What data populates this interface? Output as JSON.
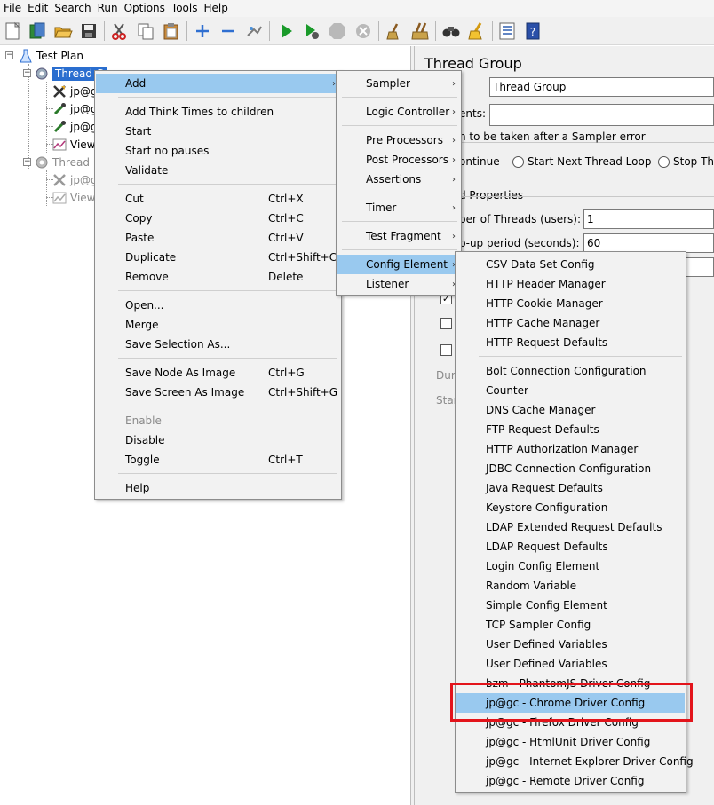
{
  "menubar": [
    "File",
    "Edit",
    "Search",
    "Run",
    "Options",
    "Tools",
    "Help"
  ],
  "toolbar": [
    "new-icon",
    "templates-icon",
    "open-icon",
    "save-icon",
    "cut-icon",
    "copy-icon",
    "paste-icon",
    "expand-icon",
    "collapse-icon",
    "toggle-icon",
    "start-icon",
    "start-no-pauses-icon",
    "stop-icon",
    "shutdown-icon",
    "clear-icon",
    "clear-all-icon",
    "search-icon",
    "reset-search-icon",
    "function-helper-icon",
    "help-icon"
  ],
  "tree": {
    "test_plan": "Test Plan",
    "thread_group_1": "Thread G",
    "child_1": "jp@g",
    "child_2": "jp@g",
    "child_3": "jp@g",
    "child_4": "View",
    "thread_group_2": "Thread",
    "child_5": "jp@g",
    "child_6": "View"
  },
  "panel": {
    "title": "Thread Group",
    "name_value": "Thread Group",
    "comments_label": "ents:",
    "error_action_label": "n to be taken after a Sampler error",
    "radio_continue": "ontinue",
    "radio_next_loop": "Start Next Thread Loop",
    "radio_stop": "Stop Thr",
    "properties_label": "d Properties",
    "threads_label": "ber of Threads (users):",
    "threads_value": "1",
    "rampup_label": "p-up period (seconds):",
    "rampup_value": "60",
    "duration_label": "Dura",
    "startup_label": "Star"
  },
  "context_menu": [
    {
      "label": "Add",
      "submenu": true,
      "highlight": true
    },
    {
      "sep": true
    },
    {
      "label": "Add Think Times to children"
    },
    {
      "label": "Start"
    },
    {
      "label": "Start no pauses"
    },
    {
      "label": "Validate"
    },
    {
      "sep": true
    },
    {
      "label": "Cut",
      "shortcut": "Ctrl+X"
    },
    {
      "label": "Copy",
      "shortcut": "Ctrl+C"
    },
    {
      "label": "Paste",
      "shortcut": "Ctrl+V"
    },
    {
      "label": "Duplicate",
      "shortcut": "Ctrl+Shift+C"
    },
    {
      "label": "Remove",
      "shortcut": "Delete"
    },
    {
      "sep": true
    },
    {
      "label": "Open..."
    },
    {
      "label": "Merge"
    },
    {
      "label": "Save Selection As..."
    },
    {
      "sep": true
    },
    {
      "label": "Save Node As Image",
      "shortcut": "Ctrl+G"
    },
    {
      "label": "Save Screen As Image",
      "shortcut": "Ctrl+Shift+G"
    },
    {
      "sep": true
    },
    {
      "label": "Enable",
      "disabled": true
    },
    {
      "label": "Disable"
    },
    {
      "label": "Toggle",
      "shortcut": "Ctrl+T"
    },
    {
      "sep": true
    },
    {
      "label": "Help"
    }
  ],
  "add_menu": [
    {
      "label": "Sampler",
      "submenu": true
    },
    {
      "sep": true
    },
    {
      "label": "Logic Controller",
      "submenu": true
    },
    {
      "sep": true
    },
    {
      "label": "Pre Processors",
      "submenu": true
    },
    {
      "label": "Post Processors",
      "submenu": true
    },
    {
      "label": "Assertions",
      "submenu": true
    },
    {
      "sep": true
    },
    {
      "label": "Timer",
      "submenu": true
    },
    {
      "sep": true
    },
    {
      "label": "Test Fragment",
      "submenu": true
    },
    {
      "sep": true
    },
    {
      "label": "Config Element",
      "submenu": true,
      "highlight": true
    },
    {
      "label": "Listener",
      "submenu": true
    }
  ],
  "config_menu": [
    {
      "label": "CSV Data Set Config"
    },
    {
      "label": "HTTP Header Manager"
    },
    {
      "label": "HTTP Cookie Manager"
    },
    {
      "label": "HTTP Cache Manager"
    },
    {
      "label": "HTTP Request Defaults"
    },
    {
      "sep": true
    },
    {
      "label": "Bolt Connection Configuration"
    },
    {
      "label": "Counter"
    },
    {
      "label": "DNS Cache Manager"
    },
    {
      "label": "FTP Request Defaults"
    },
    {
      "label": "HTTP Authorization Manager"
    },
    {
      "label": "JDBC Connection Configuration"
    },
    {
      "label": "Java Request Defaults"
    },
    {
      "label": "Keystore Configuration"
    },
    {
      "label": "LDAP Extended Request Defaults"
    },
    {
      "label": "LDAP Request Defaults"
    },
    {
      "label": "Login Config Element"
    },
    {
      "label": "Random Variable"
    },
    {
      "label": "Simple Config Element"
    },
    {
      "label": "TCP Sampler Config"
    },
    {
      "label": "User Defined Variables"
    },
    {
      "label": "User Defined Variables"
    },
    {
      "label": "bzm - PhantomJS Driver Config"
    },
    {
      "label": "jp@gc - Chrome Driver Config",
      "highlight": true
    },
    {
      "label": "jp@gc - Firefox Driver Config"
    },
    {
      "label": "jp@gc - HtmlUnit Driver Config"
    },
    {
      "label": "jp@gc - Internet Explorer Driver Config"
    },
    {
      "label": "jp@gc - Remote Driver Config"
    }
  ],
  "colors": {
    "highlight": "#99c9ef",
    "selection": "#2a6ecf",
    "annotation": "#e3141b"
  }
}
